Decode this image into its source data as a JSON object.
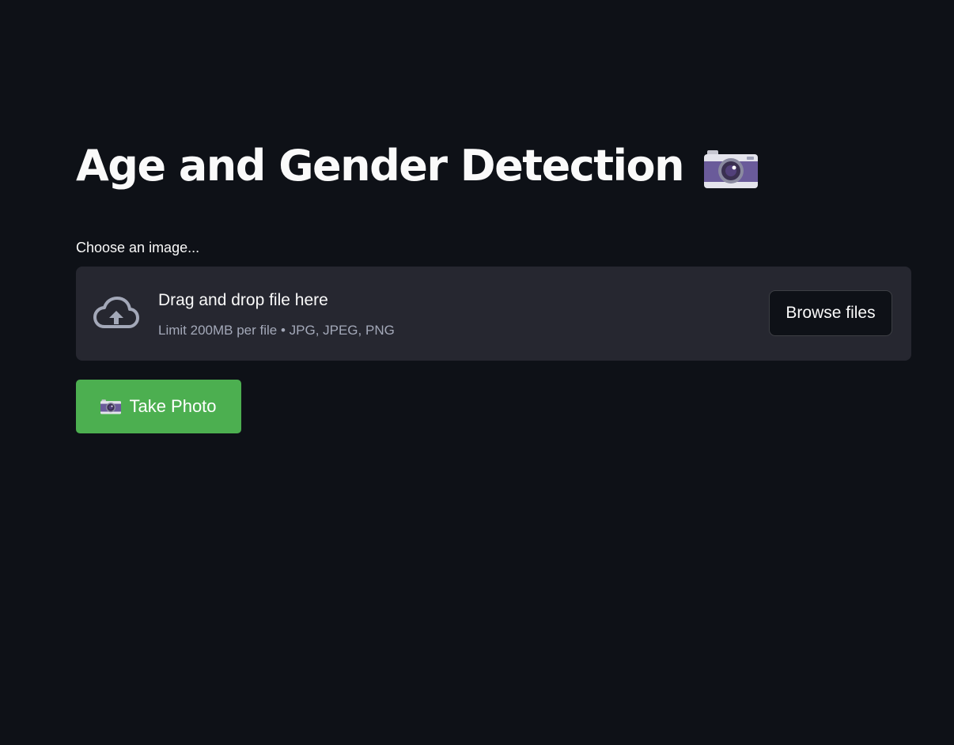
{
  "page": {
    "title": "Age and Gender Detection",
    "title_icon": "camera-icon"
  },
  "uploader": {
    "label": "Choose an image...",
    "drop_title": "Drag and drop file here",
    "drop_limit": "Limit 200MB per file • JPG, JPEG, PNG",
    "browse_label": "Browse files",
    "icon": "cloud-upload-icon"
  },
  "take_photo": {
    "label": "Take Photo",
    "icon": "camera-icon",
    "color": "#4caf50"
  },
  "theme": {
    "background": "#0e1117",
    "dropzone_bg": "#262730",
    "text": "#fafafa",
    "muted_text": "#a3a8b8"
  }
}
